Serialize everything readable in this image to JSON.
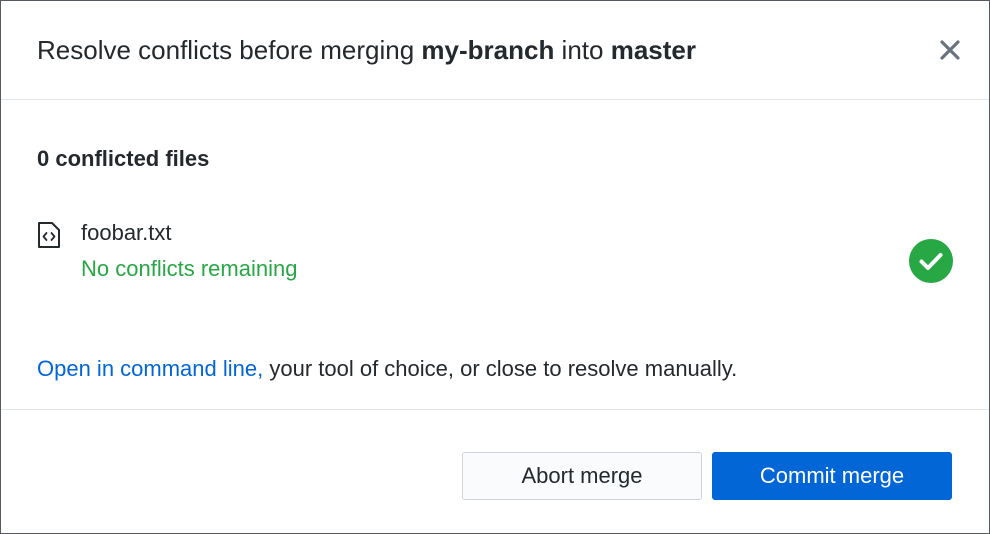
{
  "dialog": {
    "title": {
      "prefix": "Resolve conflicts before merging ",
      "branch": "my-branch",
      "middle": " into ",
      "target": "master"
    },
    "close_icon": "close-icon"
  },
  "body": {
    "conflict_count": "0 conflicted files",
    "files": [
      {
        "name": "foobar.txt",
        "status": "No conflicts remaining",
        "file_icon": "file-code-icon",
        "status_icon": "check-circle-icon"
      }
    ],
    "hint": {
      "link": "Open in command line,",
      "rest": " your tool of choice, or close to resolve manually."
    }
  },
  "footer": {
    "abort_label": "Abort merge",
    "commit_label": "Commit merge"
  },
  "colors": {
    "success": "#28a745",
    "link": "#0366d6",
    "primary_button": "#0366d6"
  }
}
